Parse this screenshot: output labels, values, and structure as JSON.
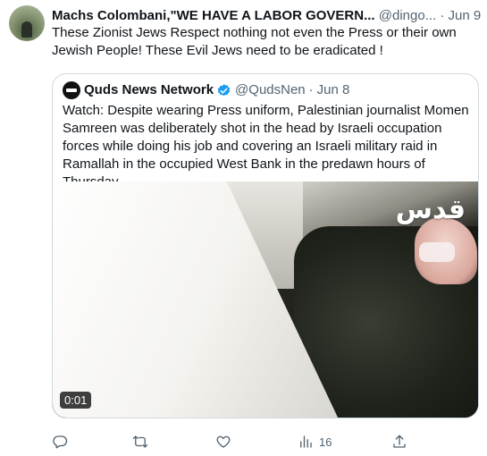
{
  "tweet": {
    "author_name": "Machs Colombani,\"WE HAVE A LABOR GOVERN...",
    "handle": "@dingo...",
    "dot": "·",
    "date": "Jun 9",
    "text": "These Zionist Jews Respect nothing not even the Press or their own Jewish People! These Evil Jews need to be eradicated !"
  },
  "quote": {
    "author_name": "Quds News Network",
    "handle": "@QudsNen",
    "dot": "·",
    "date": "Jun 8",
    "text": "Watch: Despite wearing Press uniform, Palestinian journalist Momen Samreen was deliberately shot in the head by Israeli occupation forces while doing his job and covering an Israeli military raid in Ramallah in the occupied West Bank in the predawn hours of Thursday.",
    "video": {
      "logo_text": "قدس",
      "timestamp": "0:01"
    }
  },
  "actions": {
    "reply_icon": "reply-icon",
    "retweet_icon": "retweet-icon",
    "like_icon": "like-icon",
    "views_icon": "views-icon",
    "views_count": "16",
    "share_icon": "share-icon"
  },
  "colors": {
    "text": "#0f1419",
    "secondary": "#536471",
    "border": "#cfd9de",
    "verified": "#1d9bf0"
  }
}
